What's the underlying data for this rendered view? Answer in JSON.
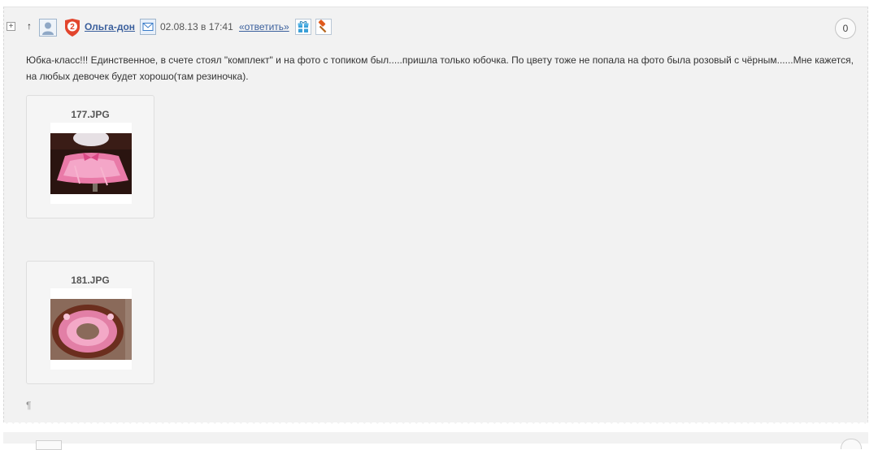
{
  "comment": {
    "author": "Ольга-дон",
    "rank_badge": "2",
    "datetime": "02.08.13 в 17:41",
    "reply_label": "«ответить»",
    "rating": "0",
    "expand_symbol": "+",
    "parent_symbol": "↑",
    "text_line1": "Юбка-класс!!! Единственное, в счете стоял \"комплект\" и на фото с топиком был.....пришла только юбочка. По цвету тоже не попала на фото была розовый с чёрным......Мне кажется,",
    "text_line2": "на любых девочек будет хорошо(там резиночка).",
    "attachments": [
      {
        "filename": "177.JPG"
      },
      {
        "filename": "181.JPG"
      }
    ],
    "end_mark": "¶"
  },
  "icons": {
    "avatar": "user-avatar-icon",
    "badge": "rank-shield-icon",
    "mail": "mail-envelope-icon",
    "gift": "gift-icon",
    "hammer": "hammer-icon"
  },
  "colors": {
    "link": "#3a5f9c",
    "badge": "#e2452d",
    "panel": "#f2f2f2"
  }
}
